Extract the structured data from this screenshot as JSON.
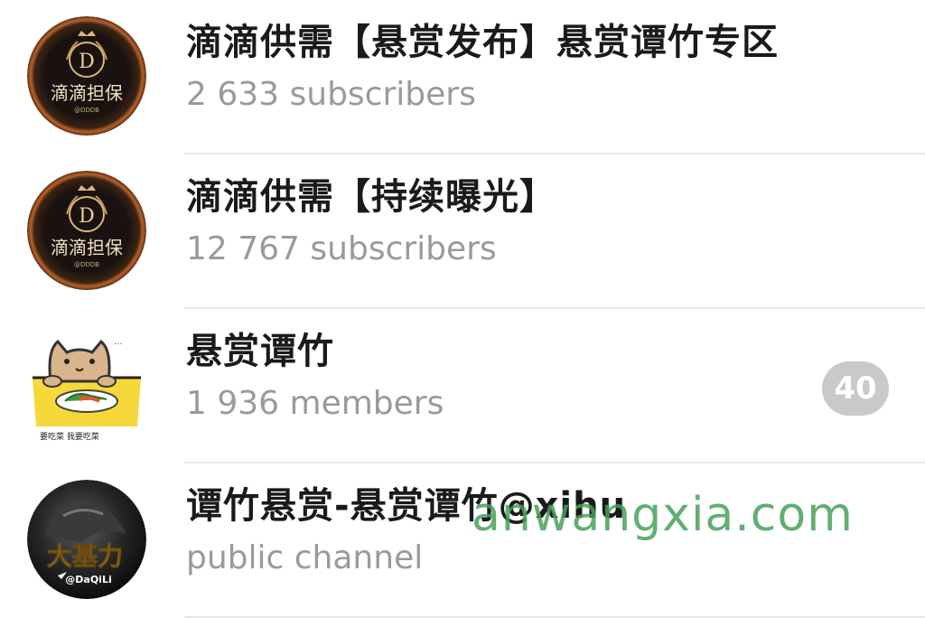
{
  "chats": [
    {
      "title": "滴滴供需【悬赏发布】悬赏谭竹专区",
      "subtitle": "2 633 subscribers",
      "avatar": {
        "icon": "didi-escrow-logo-icon",
        "letter": "D",
        "text": "滴滴担保",
        "small": "@DDDB"
      }
    },
    {
      "title": "滴滴供需【持续曝光】",
      "subtitle": "12 767 subscribers",
      "avatar": {
        "icon": "didi-escrow-logo-icon",
        "letter": "D",
        "text": "滴滴担保",
        "small": "@DDDB"
      }
    },
    {
      "title": "悬赏谭竹",
      "subtitle": "1 936 members",
      "badge": "40",
      "avatar": {
        "icon": "cat-eating-sticker-icon",
        "text": "要吃菜 我要吃菜"
      }
    },
    {
      "title": "谭竹悬赏-悬赏谭竹@xihu",
      "subtitle": "public channel",
      "avatar": {
        "icon": "daqili-logo-icon",
        "text": "大基力",
        "small": "@DaQiLi"
      }
    }
  ],
  "watermark": "anwangxia.com",
  "colors": {
    "title": "#1a1a1a",
    "subtitle": "#9a9a9a",
    "badge": "#c9c9c9",
    "watermark": "#46a05a"
  }
}
